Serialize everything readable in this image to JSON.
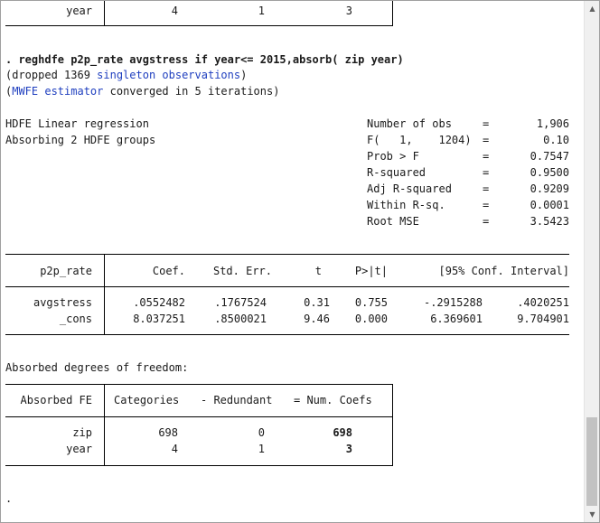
{
  "top_table": {
    "label": "year",
    "categories": "4",
    "redundant": "1",
    "num_coefs": "3"
  },
  "command": ". reghdfe p2p_rate avgstress if year<= 2015,absorb( zip year)",
  "notes": {
    "dropped_pre": "(dropped 1369 ",
    "dropped_link": "singleton observations",
    "dropped_post": ")",
    "mwfe_pre": "(",
    "mwfe_link": "MWFE estimator",
    "mwfe_post": " converged in 5 iterations)"
  },
  "header_left": [
    "HDFE Linear regression",
    "Absorbing 2 HDFE groups"
  ],
  "stats": [
    {
      "label": "Number of obs",
      "eq": "=",
      "value": "1,906"
    },
    {
      "label": "F(   1,    1204)",
      "eq": "=",
      "value": "0.10"
    },
    {
      "label": "Prob > F",
      "eq": "=",
      "value": "0.7547"
    },
    {
      "label": "R-squared",
      "eq": "=",
      "value": "0.9500"
    },
    {
      "label": "Adj R-squared",
      "eq": "=",
      "value": "0.9209"
    },
    {
      "label": "Within R-sq.",
      "eq": "=",
      "value": "0.0001"
    },
    {
      "label": "Root MSE",
      "eq": "=",
      "value": "3.5423"
    }
  ],
  "coef_table": {
    "depvar": "p2p_rate",
    "headers": [
      "Coef.",
      "Std. Err.",
      "t",
      "P>|t|",
      "[95% Conf. Interval]"
    ],
    "rows": [
      {
        "name": "avgstress",
        "coef": ".0552482",
        "se": ".1767524",
        "t": "0.31",
        "p": "0.755",
        "lo": "-.2915288",
        "hi": ".4020251"
      },
      {
        "name": "_cons",
        "coef": "8.037251",
        "se": ".8500021",
        "t": "9.46",
        "p": "0.000",
        "lo": "6.369601",
        "hi": "9.704901"
      }
    ]
  },
  "absorbed": {
    "title": "Absorbed degrees of freedom:",
    "headers": [
      "Absorbed FE",
      "Categories",
      "- Redundant",
      "= Num. Coefs"
    ],
    "rows": [
      {
        "name": "zip",
        "categories": "698",
        "redundant": "0",
        "coefs": "698"
      },
      {
        "name": "year",
        "categories": "4",
        "redundant": "1",
        "coefs": "3"
      }
    ]
  },
  "prompt": "."
}
